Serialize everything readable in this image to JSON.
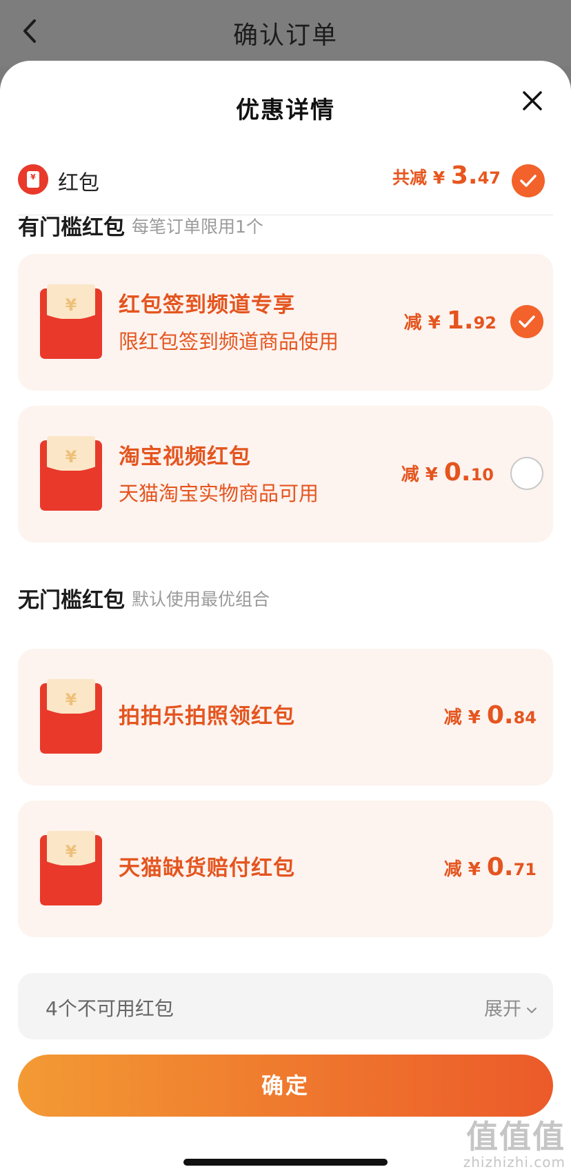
{
  "topnav": {
    "title": "确认订单"
  },
  "sheet": {
    "title": "优惠详情"
  },
  "summary": {
    "label": "红包",
    "prefix": "共减 ¥ ",
    "int": "3.",
    "dec": "47",
    "icon_yen": "¥"
  },
  "sections": [
    {
      "title": "有门槛红包",
      "note": "每笔订单限用1个"
    },
    {
      "title": "无门槛红包",
      "note": "默认使用最优组合"
    }
  ],
  "coupons": [
    {
      "title": "红包签到频道专享",
      "desc": "限红包签到频道商品使用",
      "prefix": "减 ¥ ",
      "int": "1.",
      "dec": "92",
      "selected": true
    },
    {
      "title": "淘宝视频红包",
      "desc": "天猫淘宝实物商品可用",
      "prefix": "减 ¥ ",
      "int": "0.",
      "dec": "10",
      "selected": false
    },
    {
      "title": "拍拍乐拍照领红包",
      "desc": "",
      "prefix": "减 ¥ ",
      "int": "0.",
      "dec": "84"
    },
    {
      "title": "天猫缺货赔付红包",
      "desc": "",
      "prefix": "减 ¥ ",
      "int": "0.",
      "dec": "71"
    }
  ],
  "unavailable": {
    "label": "4个不可用红包",
    "expand": "展开"
  },
  "confirm_label": "确定",
  "watermark": {
    "main": "值值值",
    "sub": "zhizhizhi.com"
  },
  "icons": [
    "back-icon",
    "close-icon",
    "hongbao-icon",
    "check-icon",
    "envelope-icon",
    "chevron-down-icon"
  ],
  "colors": {
    "accent": "#e4551f",
    "check": "#f2622a",
    "card_bg": "#fdf3ef",
    "envelope": "#e8392b"
  }
}
